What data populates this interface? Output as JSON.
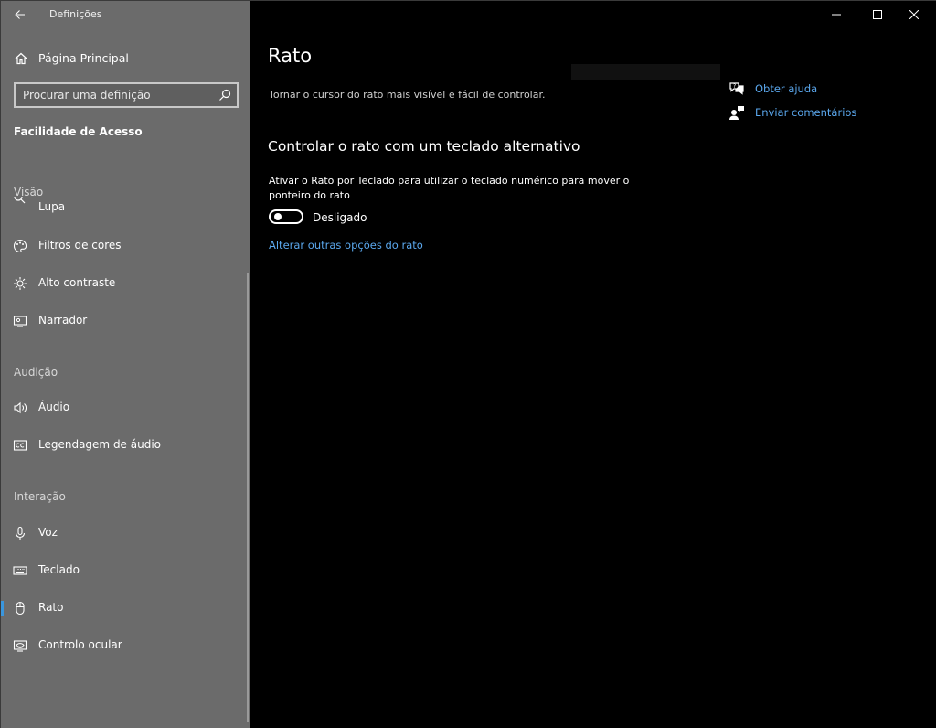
{
  "app": {
    "title": "Definições"
  },
  "sidebar": {
    "home_label": "Página Principal",
    "search_placeholder": "Procurar uma definição",
    "section_heading": "Facilidade de Acesso",
    "groups": {
      "visao": "Visão",
      "audicao": "Audição",
      "interacao": "Interação"
    },
    "items": {
      "lupa": "Lupa",
      "filtros": "Filtros de cores",
      "contraste": "Alto contraste",
      "narrador": "Narrador",
      "audio": "Áudio",
      "legendagem": "Legendagem de áudio",
      "voz": "Voz",
      "teclado": "Teclado",
      "rato": "Rato",
      "controlo_ocular": "Controlo ocular"
    },
    "selected": "rato"
  },
  "main": {
    "title": "Rato",
    "description": "Tornar o cursor do rato mais visível e fácil de controlar.",
    "section_title": "Controlar o rato com um teclado alternativo",
    "setting_description": "Ativar o Rato por Teclado para utilizar o teclado numérico para mover o ponteiro do rato",
    "toggle_state": "Desligado",
    "link_more": "Alterar outras opções do rato"
  },
  "help": {
    "get_help": "Obter ajuda",
    "feedback": "Enviar comentários"
  },
  "colors": {
    "sidebar_bg": "#6b6b6b",
    "main_bg": "#000000",
    "accent": "#3a96dd",
    "link": "#5ba8ee"
  }
}
